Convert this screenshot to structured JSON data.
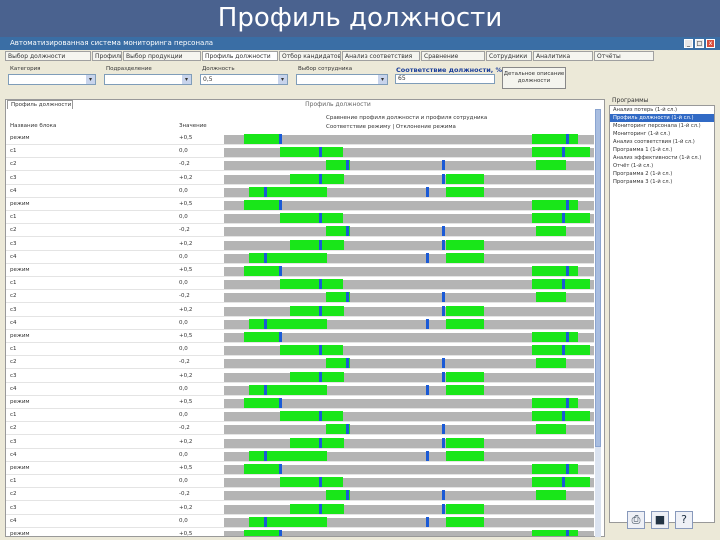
{
  "slide_title": "Профиль должности",
  "window": {
    "title": "Автоматизированная система мониторинга персонала",
    "controls": [
      "_",
      "□",
      "x"
    ]
  },
  "top_tabs": [
    "Выбор должности",
    "Профиль",
    "Выбор продукции",
    "Профиль должности",
    "Отбор кандидатов",
    "Анализ соответствия",
    "Сравнение",
    "Сотрудники",
    "Аналитика",
    "Отчёты"
  ],
  "toolbar": {
    "labels": [
      "Категория",
      "Подразделение",
      "Должность",
      "Уровень",
      "Выбор сотрудника"
    ],
    "combo_values": [
      "",
      "",
      "",
      "0,5",
      ""
    ],
    "match_label": "Соответствие должности, %",
    "match_value": "65",
    "action_button": "Детальное описание должности"
  },
  "panel": {
    "tab_label": "Профиль должности",
    "caption": "Профиль должности",
    "col_name": "Название блока",
    "col_value": "Значение",
    "chart_caption": "Сравнение профиля должности и профиля сотрудника",
    "chart_legend": "Соответствие режиму | Отклонение режима"
  },
  "rows": [
    {
      "name": "режим",
      "val": "+0,5",
      "segs": [
        [
          20,
          35
        ],
        [
          308,
          46
        ]
      ],
      "mk": [
        55,
        342
      ]
    },
    {
      "name": "с1",
      "val": "0,0",
      "segs": [
        [
          56,
          63
        ],
        [
          308,
          58
        ]
      ],
      "mk": [
        95,
        338
      ]
    },
    {
      "name": "с2",
      "val": "-0,2",
      "segs": [
        [
          102,
          24
        ],
        [
          312,
          30
        ]
      ],
      "mk": [
        122,
        218
      ]
    },
    {
      "name": "с3",
      "val": "+0,2",
      "segs": [
        [
          66,
          54
        ],
        [
          222,
          38
        ]
      ],
      "mk": [
        95,
        218
      ]
    },
    {
      "name": "с4",
      "val": "0,0",
      "segs": [
        [
          25,
          78
        ],
        [
          222,
          38
        ]
      ],
      "mk": [
        40,
        202
      ]
    },
    {
      "name": "режим",
      "val": "+0,5",
      "segs": [
        [
          20,
          35
        ],
        [
          308,
          46
        ]
      ],
      "mk": [
        55,
        342
      ]
    },
    {
      "name": "с1",
      "val": "0,0",
      "segs": [
        [
          56,
          63
        ],
        [
          308,
          58
        ]
      ],
      "mk": [
        95,
        338
      ]
    },
    {
      "name": "с2",
      "val": "-0,2",
      "segs": [
        [
          102,
          24
        ],
        [
          312,
          30
        ]
      ],
      "mk": [
        122,
        218
      ]
    },
    {
      "name": "с3",
      "val": "+0,2",
      "segs": [
        [
          66,
          54
        ],
        [
          222,
          38
        ]
      ],
      "mk": [
        95,
        218
      ]
    },
    {
      "name": "с4",
      "val": "0,0",
      "segs": [
        [
          25,
          78
        ],
        [
          222,
          38
        ]
      ],
      "mk": [
        40,
        202
      ]
    },
    {
      "name": "режим",
      "val": "+0,5",
      "segs": [
        [
          20,
          35
        ],
        [
          308,
          46
        ]
      ],
      "mk": [
        55,
        342
      ]
    },
    {
      "name": "с1",
      "val": "0,0",
      "segs": [
        [
          56,
          63
        ],
        [
          308,
          58
        ]
      ],
      "mk": [
        95,
        338
      ]
    },
    {
      "name": "с2",
      "val": "-0,2",
      "segs": [
        [
          102,
          24
        ],
        [
          312,
          30
        ]
      ],
      "mk": [
        122,
        218
      ]
    },
    {
      "name": "с3",
      "val": "+0,2",
      "segs": [
        [
          66,
          54
        ],
        [
          222,
          38
        ]
      ],
      "mk": [
        95,
        218
      ]
    },
    {
      "name": "с4",
      "val": "0,0",
      "segs": [
        [
          25,
          78
        ],
        [
          222,
          38
        ]
      ],
      "mk": [
        40,
        202
      ]
    },
    {
      "name": "режим",
      "val": "+0,5",
      "segs": [
        [
          20,
          35
        ],
        [
          308,
          46
        ]
      ],
      "mk": [
        55,
        342
      ]
    },
    {
      "name": "с1",
      "val": "0,0",
      "segs": [
        [
          56,
          63
        ],
        [
          308,
          58
        ]
      ],
      "mk": [
        95,
        338
      ]
    },
    {
      "name": "с2",
      "val": "-0,2",
      "segs": [
        [
          102,
          24
        ],
        [
          312,
          30
        ]
      ],
      "mk": [
        122,
        218
      ]
    },
    {
      "name": "с3",
      "val": "+0,2",
      "segs": [
        [
          66,
          54
        ],
        [
          222,
          38
        ]
      ],
      "mk": [
        95,
        218
      ]
    },
    {
      "name": "с4",
      "val": "0,0",
      "segs": [
        [
          25,
          78
        ],
        [
          222,
          38
        ]
      ],
      "mk": [
        40,
        202
      ]
    },
    {
      "name": "режим",
      "val": "+0,5",
      "segs": [
        [
          20,
          35
        ],
        [
          308,
          46
        ]
      ],
      "mk": [
        55,
        342
      ]
    },
    {
      "name": "с1",
      "val": "0,0",
      "segs": [
        [
          56,
          63
        ],
        [
          308,
          58
        ]
      ],
      "mk": [
        95,
        338
      ]
    },
    {
      "name": "с2",
      "val": "-0,2",
      "segs": [
        [
          102,
          24
        ],
        [
          312,
          30
        ]
      ],
      "mk": [
        122,
        218
      ]
    },
    {
      "name": "с3",
      "val": "+0,2",
      "segs": [
        [
          66,
          54
        ],
        [
          222,
          38
        ]
      ],
      "mk": [
        95,
        218
      ]
    },
    {
      "name": "с4",
      "val": "0,0",
      "segs": [
        [
          25,
          78
        ],
        [
          222,
          38
        ]
      ],
      "mk": [
        40,
        202
      ]
    },
    {
      "name": "режим",
      "val": "+0,5",
      "segs": [
        [
          20,
          35
        ],
        [
          308,
          46
        ]
      ],
      "mk": [
        55,
        342
      ]
    },
    {
      "name": "с1",
      "val": "0,0",
      "segs": [
        [
          56,
          63
        ],
        [
          308,
          58
        ]
      ],
      "mk": [
        95,
        338
      ]
    },
    {
      "name": "с2",
      "val": "-0,2",
      "segs": [
        [
          102,
          24
        ],
        [
          312,
          30
        ]
      ],
      "mk": [
        122,
        218
      ]
    },
    {
      "name": "с3",
      "val": "+0,2",
      "segs": [
        [
          66,
          54
        ],
        [
          222,
          38
        ]
      ],
      "mk": [
        95,
        218
      ]
    },
    {
      "name": "с4",
      "val": "0,0",
      "segs": [
        [
          25,
          78
        ],
        [
          222,
          38
        ]
      ],
      "mk": [
        40,
        202
      ]
    },
    {
      "name": "режим",
      "val": "+0,5",
      "segs": [
        [
          20,
          35
        ],
        [
          308,
          46
        ]
      ],
      "mk": [
        55,
        342
      ]
    },
    {
      "name": "с1",
      "val": "0,0",
      "segs": [
        [
          56,
          63
        ],
        [
          308,
          58
        ]
      ],
      "mk": [
        95,
        338
      ]
    }
  ],
  "right_panel": {
    "label": "Программы",
    "items": [
      "Анализ потерь (1-й сл.)",
      "Профиль должности (1-й сл.)",
      "Мониторинг персонала (1-й сл.)",
      "Мониторинг (1-й сл.)",
      "Анализ соответствия (1-й сл.)",
      "Программа 1 (1-й сл.)",
      "Анализ эффективности (1-й сл.)",
      "Отчёт (1-й сл.)",
      "Программа 2 (1-й сл.)",
      "Программа 3 (1-й сл.)"
    ],
    "selected": 1
  },
  "bottom_icons": [
    "printer-icon",
    "save-icon",
    "help-icon"
  ]
}
